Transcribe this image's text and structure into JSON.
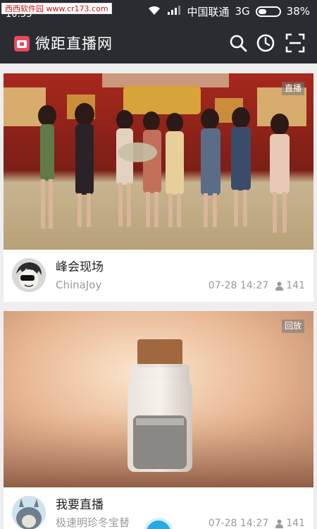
{
  "statusbar": {
    "watermark": "西西软件园 www.cr173.com",
    "clock": "10:55",
    "carrier": "中国联通",
    "network": "3G",
    "battery_percent": "38%",
    "battery_level": 0.38
  },
  "appbar": {
    "title": "微距直播网",
    "icons": [
      "search-icon",
      "history-icon",
      "scan-icon"
    ]
  },
  "feed": [
    {
      "tag": "直播",
      "title": "峰会现场",
      "subtitle": "ChinaJoy",
      "time": "07-28  14:27",
      "viewers": "141"
    },
    {
      "tag": "回放",
      "title": "我要直播",
      "subtitle": "极速明珍冬宝替",
      "time": "07-28  14:27",
      "viewers": "141"
    }
  ],
  "colors": {
    "header_bg": "#2b2c31",
    "accent": "#27a9e1",
    "logo": "#e8495b"
  }
}
